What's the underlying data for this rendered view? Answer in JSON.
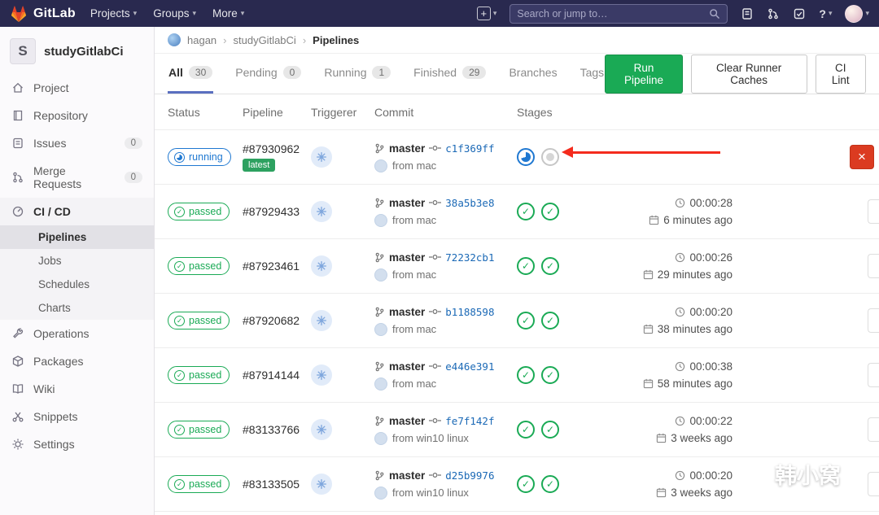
{
  "navbar": {
    "brand": "GitLab",
    "menus": [
      {
        "label": "Projects"
      },
      {
        "label": "Groups"
      },
      {
        "label": "More"
      }
    ],
    "search_placeholder": "Search or jump to…"
  },
  "glyphs": {
    "chevron_down": "▾",
    "separator": "›",
    "plus": "+",
    "question": "?",
    "check": "✓",
    "close": "×"
  },
  "icons": {
    "navbar": [
      "gitlab-tanuki-logo",
      "plus-dropdown",
      "search",
      "issues",
      "merge-requests",
      "todos",
      "help",
      "user-avatar"
    ],
    "sidebar": [
      "home",
      "repository",
      "issues",
      "merge-request",
      "cicd",
      "operations",
      "packages",
      "wiki",
      "snippets",
      "settings"
    ],
    "table": [
      "branch",
      "commit",
      "clock",
      "calendar",
      "identicon-avatar"
    ]
  },
  "sidebar": {
    "project_initial": "S",
    "project_name": "studyGitlabCi",
    "items": [
      {
        "label": "Project"
      },
      {
        "label": "Repository"
      },
      {
        "label": "Issues",
        "count": "0"
      },
      {
        "label": "Merge Requests",
        "count": "0"
      },
      {
        "label": "CI / CD",
        "active": true
      },
      {
        "label": "Operations"
      },
      {
        "label": "Packages"
      },
      {
        "label": "Wiki"
      },
      {
        "label": "Snippets"
      },
      {
        "label": "Settings"
      }
    ],
    "cicd_subitems": [
      {
        "label": "Pipelines",
        "active": true
      },
      {
        "label": "Jobs"
      },
      {
        "label": "Schedules"
      },
      {
        "label": "Charts"
      }
    ]
  },
  "breadcrumb": {
    "items": [
      "hagan",
      "studyGitlabCi",
      "Pipelines"
    ]
  },
  "tabs": [
    {
      "label": "All",
      "count": "30",
      "active": true
    },
    {
      "label": "Pending",
      "count": "0"
    },
    {
      "label": "Running",
      "count": "1"
    },
    {
      "label": "Finished",
      "count": "29"
    },
    {
      "label": "Branches"
    },
    {
      "label": "Tags"
    }
  ],
  "actions": {
    "run_pipeline": "Run Pipeline",
    "clear_runner_caches": "Clear Runner Caches",
    "ci_lint": "CI Lint"
  },
  "table": {
    "headers": [
      "Status",
      "Pipeline",
      "Triggerer",
      "Commit",
      "Stages"
    ],
    "latest_label": "latest",
    "rows": [
      {
        "status": "running",
        "id": "#87930962",
        "latest": true,
        "branch": "master",
        "sha": "c1f369ff",
        "from": "from mac",
        "stages": [
          "running",
          "created"
        ],
        "duration": "",
        "time_ago": ""
      },
      {
        "status": "passed",
        "id": "#87929433",
        "branch": "master",
        "sha": "38a5b3e8",
        "from": "from mac",
        "stages": [
          "passed",
          "passed"
        ],
        "duration": "00:00:28",
        "time_ago": "6 minutes ago"
      },
      {
        "status": "passed",
        "id": "#87923461",
        "branch": "master",
        "sha": "72232cb1",
        "from": "from mac",
        "stages": [
          "passed",
          "passed"
        ],
        "duration": "00:00:26",
        "time_ago": "29 minutes ago"
      },
      {
        "status": "passed",
        "id": "#87920682",
        "branch": "master",
        "sha": "b1188598",
        "from": "from mac",
        "stages": [
          "passed",
          "passed"
        ],
        "duration": "00:00:20",
        "time_ago": "38 minutes ago"
      },
      {
        "status": "passed",
        "id": "#87914144",
        "branch": "master",
        "sha": "e446e391",
        "from": "from mac",
        "stages": [
          "passed",
          "passed"
        ],
        "duration": "00:00:38",
        "time_ago": "58 minutes ago"
      },
      {
        "status": "passed",
        "id": "#83133766",
        "branch": "master",
        "sha": "fe7f142f",
        "from": "from win10 linux",
        "stages": [
          "passed",
          "passed"
        ],
        "duration": "00:00:22",
        "time_ago": "3 weeks ago"
      },
      {
        "status": "passed",
        "id": "#83133505",
        "branch": "master",
        "sha": "d25b9976",
        "from": "from win10 linux",
        "stages": [
          "passed",
          "passed"
        ],
        "duration": "00:00:20",
        "time_ago": "3 weeks ago"
      }
    ]
  },
  "watermark": "韩小窝",
  "colors": {
    "navbar_bg": "#29294f",
    "link_blue": "#1b69b6",
    "green": "#1aaa55",
    "running_blue": "#1f78d1",
    "cancel_red": "#db3b21",
    "arrow_red": "#f42b1d",
    "tab_indicator": "#5a6fc0"
  }
}
